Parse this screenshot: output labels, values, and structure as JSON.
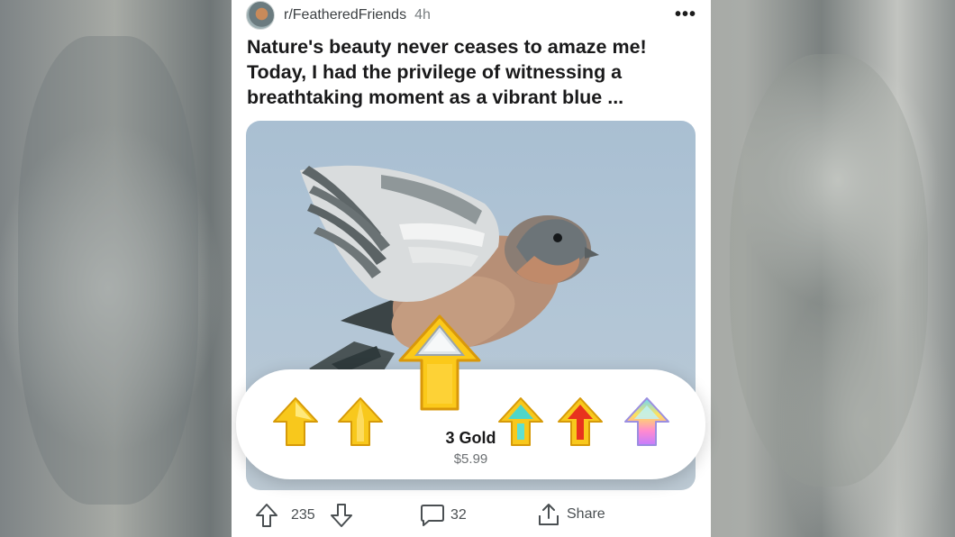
{
  "post": {
    "subreddit": "r/FeatheredFriends",
    "age": "4h",
    "more_icon": "more-horizontal-icon",
    "title": "Nature's beauty never ceases to amaze me! Today, I had the privilege of witnessing a breathtaking moment as a vibrant blue ..."
  },
  "award_picker": {
    "selected": {
      "name": "3 Gold",
      "price": "$5.99"
    },
    "awards": [
      "gold-upvote-award",
      "gold-upvote-award",
      "gold-upvote-award-large",
      "teal-gold-upvote-award",
      "red-gold-upvote-award",
      "rainbow-upvote-award"
    ]
  },
  "actions": {
    "upvote_icon": "upvote-arrow-icon",
    "score": "235",
    "downvote_icon": "downvote-arrow-icon",
    "comments_icon": "comment-bubble-icon",
    "comments": "32",
    "share_icon": "share-icon",
    "share_label": "Share"
  }
}
